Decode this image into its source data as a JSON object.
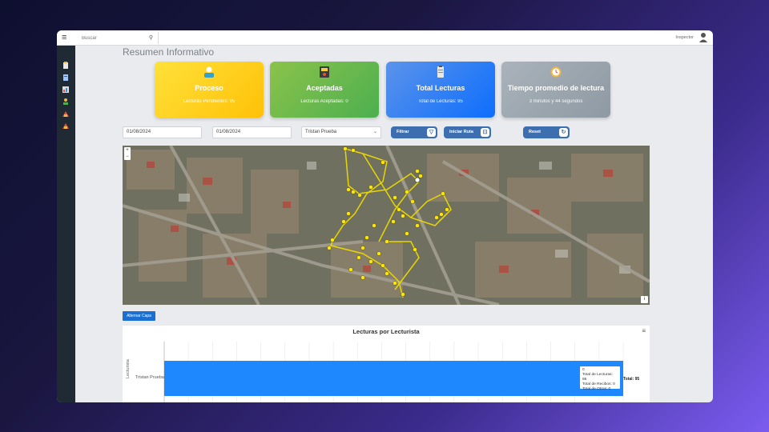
{
  "topbar": {
    "search_placeholder": "Buscar",
    "user_role": "Inspector"
  },
  "sidebar": {
    "icons": [
      "clipboard-icon",
      "document-icon",
      "report-icon",
      "user-pin-icon",
      "building-icon",
      "building-alt-icon"
    ]
  },
  "page": {
    "title": "Resumen Informativo"
  },
  "cards": [
    {
      "title": "Proceso",
      "subtitle": "Lecturas Pendientes: 95",
      "icon": "reader-icon",
      "color_from": "#ffe13a",
      "color_to": "#ffc107"
    },
    {
      "title": "Aceptadas",
      "subtitle": "Lecturas Aceptadas: 0",
      "icon": "meter-icon",
      "color_from": "#8bc34a",
      "color_to": "#4caf50"
    },
    {
      "title": "Total Lecturas",
      "subtitle": "Total de Lecturas: 95",
      "icon": "clipboard-icon",
      "color_from": "#5b93ea",
      "color_to": "#0d6efd"
    },
    {
      "title": "Tiempo promedio de lectura",
      "subtitle": "3 minutos y 44 segundos",
      "icon": "clock-icon",
      "color_from": "#aab3bb",
      "color_to": "#8e99a3"
    }
  ],
  "filters": {
    "date_from": "01/08/2024",
    "date_to": "01/08/2024",
    "reader_select": "Tristan Prueba",
    "filter_button": "Filtrar",
    "route_button": "Iniciar Ruta",
    "reset_button": "Reset"
  },
  "map": {
    "zoom_in": "+",
    "zoom_out": "−",
    "info": "i"
  },
  "layer_button": "Alternar Capa",
  "chart_data": {
    "type": "bar",
    "title": "Lecturas por Lecturista",
    "ylabel": "Lecturista",
    "categories": [
      "Tristan Prueba"
    ],
    "values": [
      95
    ],
    "total_label": "Total: 95",
    "tooltip": {
      "line1": "0",
      "line2": "Total de Lecturas: 95",
      "line3": "Total de Recibos: 0",
      "line4": "Total de Otros: 0"
    },
    "bar_color": "#1e88ff",
    "grid": true
  }
}
